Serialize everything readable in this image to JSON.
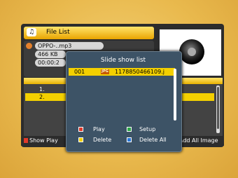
{
  "header": {
    "title": "File List",
    "icon": "music-note-icon"
  },
  "file_info": {
    "name": "OPPO-..mp3",
    "size": "466 KB",
    "time": "00:00:2"
  },
  "list": [
    {
      "index": "1.",
      "icon": "jpg-icon"
    },
    {
      "index": "2.",
      "icon": "jpg-icon"
    }
  ],
  "bottom": {
    "left_label": "Show Play",
    "right_label": "Add All Image"
  },
  "dialog": {
    "title": "Slide show list",
    "items": [
      {
        "index": "001",
        "icon": "jpg-icon",
        "name": "1178850466109.j"
      }
    ],
    "keys": {
      "play": "Play",
      "setup": "Setup",
      "delete": "Delete",
      "delete_all": "Delete All"
    }
  },
  "colors": {
    "background": "#e9b94d",
    "highlight": "#f4d000",
    "dialog_bg": "#3d5366",
    "key_red": "#e03a2a",
    "key_green": "#2ea84a",
    "key_yellow": "#f4d000",
    "key_blue": "#2a78d8"
  }
}
